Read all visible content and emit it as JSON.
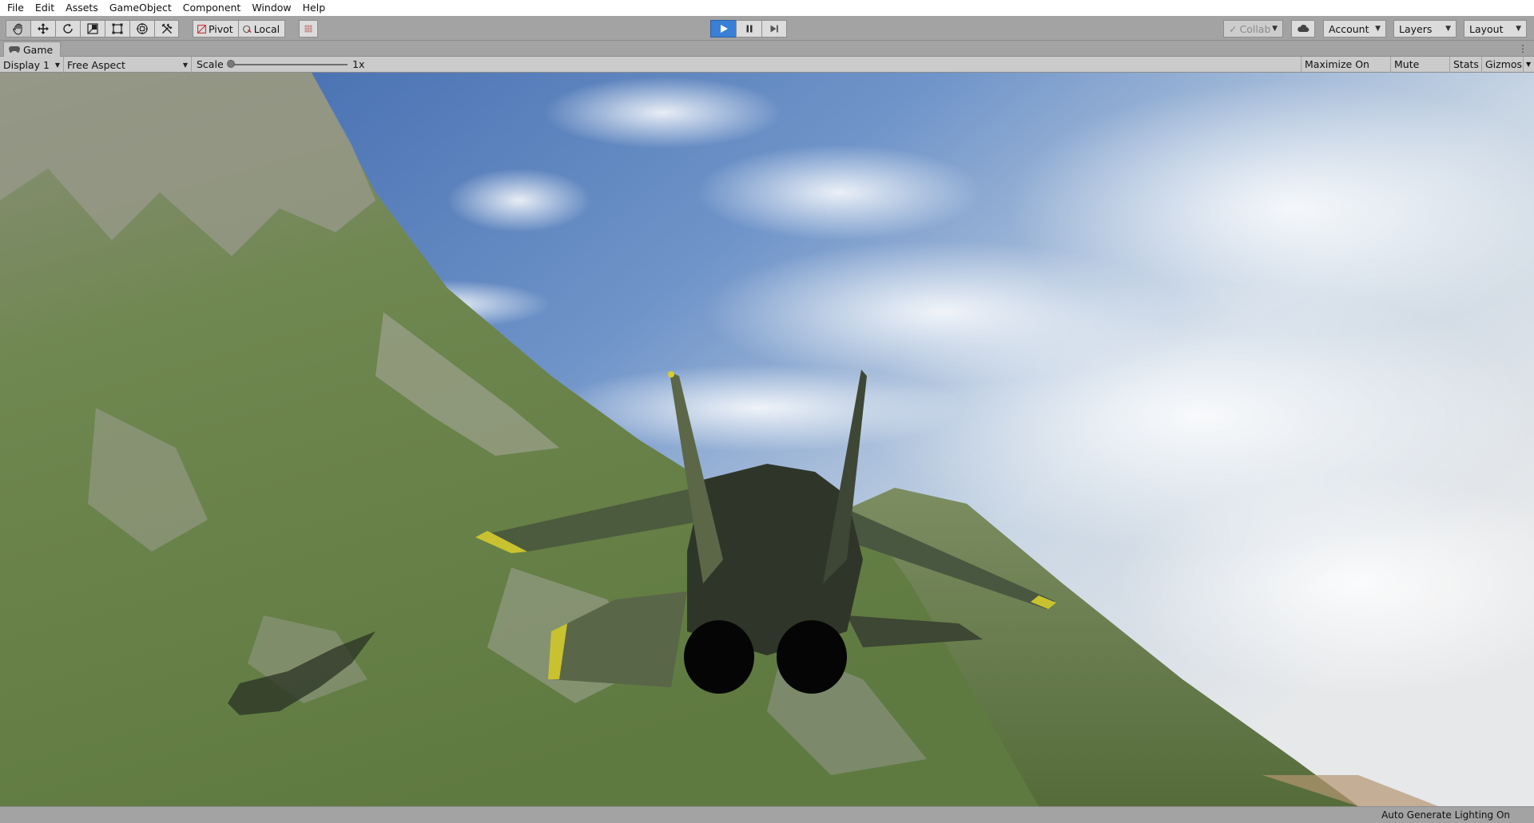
{
  "menu": [
    "File",
    "Edit",
    "Assets",
    "GameObject",
    "Component",
    "Window",
    "Help"
  ],
  "toolbar": {
    "tools": [
      {
        "icon": "hand-icon"
      },
      {
        "icon": "move-icon"
      },
      {
        "icon": "rotate-icon"
      },
      {
        "icon": "scale-icon"
      },
      {
        "icon": "rect-tool-icon"
      },
      {
        "icon": "transform-tool-icon"
      },
      {
        "icon": "custom-tool-icon"
      }
    ],
    "pivot_label": "Pivot",
    "local_label": "Local",
    "play_state": "playing",
    "collab_label": "Collab",
    "account_label": "Account",
    "layers_label": "Layers",
    "layout_label": "Layout"
  },
  "game_tab": {
    "label": "Game",
    "icon": "gamepad-icon"
  },
  "game_options": {
    "display": "Display 1",
    "aspect": "Free Aspect",
    "scale_label": "Scale",
    "scale_value": "1x",
    "maximize_label": "Maximize On Play",
    "mute_label": "Mute Audio",
    "stats_label": "Stats",
    "gizmos_label": "Gizmos"
  },
  "status": {
    "text": "Auto Generate Lighting On"
  },
  "colors": {
    "play_accent": "#3a7fd5",
    "sky_top": "#3f6aae",
    "terrain": "#6f8450",
    "jet": "#3b4433",
    "jet_accent": "#c9c230"
  }
}
